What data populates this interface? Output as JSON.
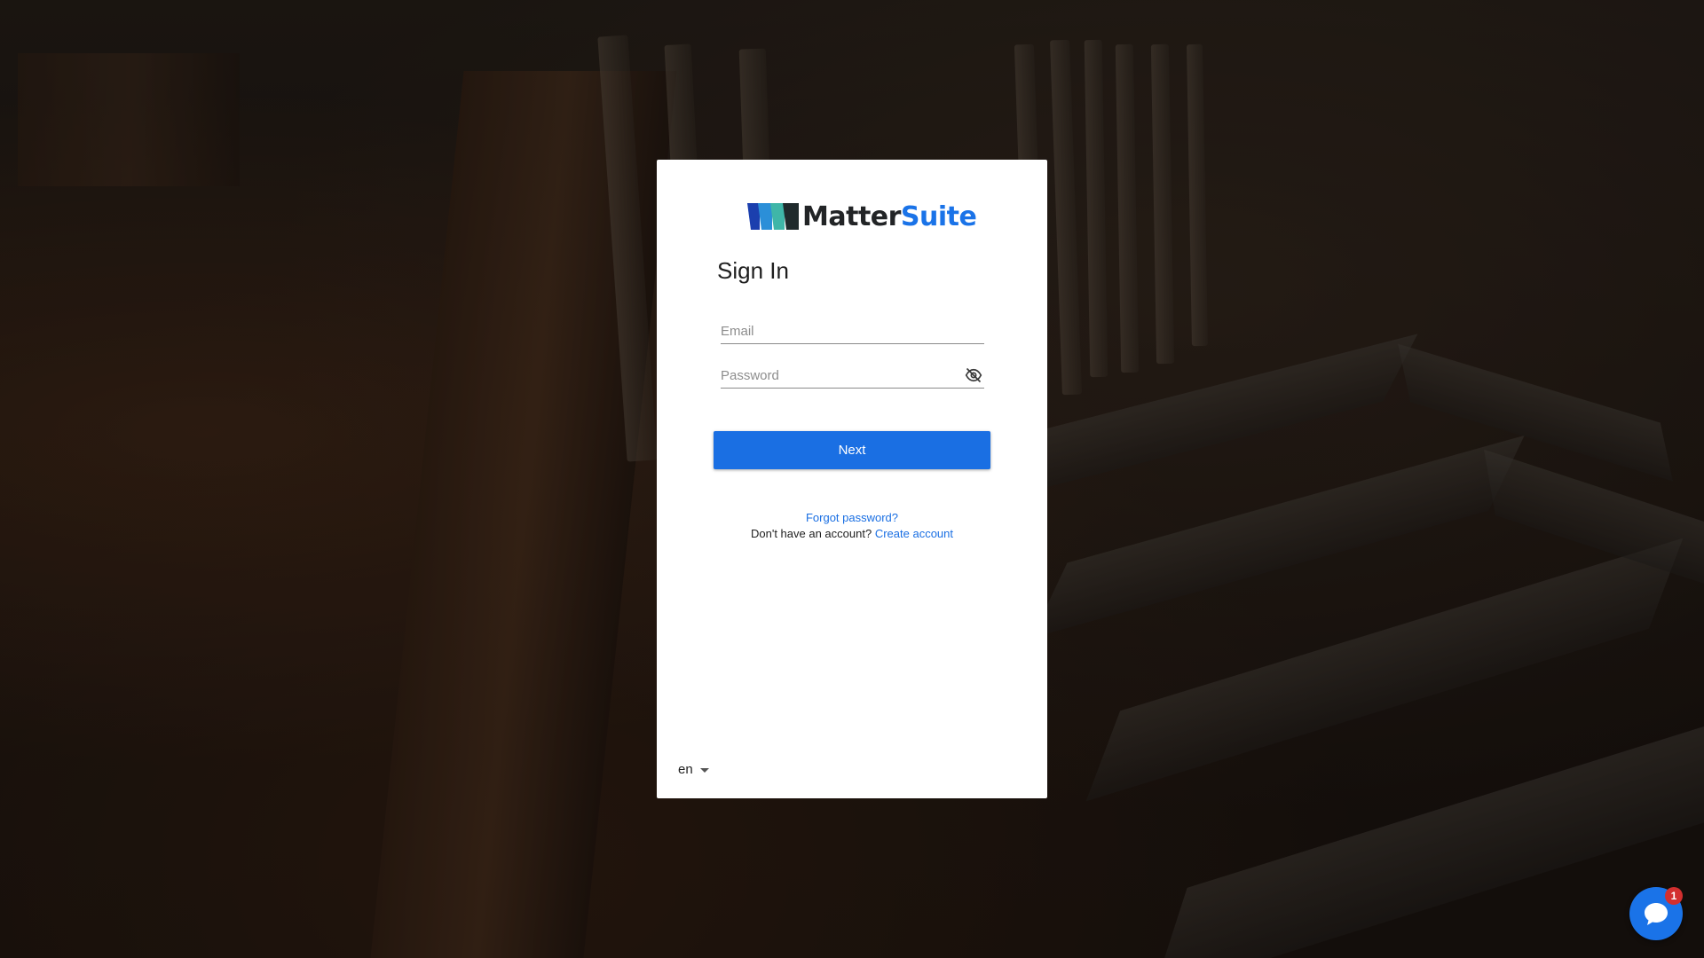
{
  "brand": {
    "name_part1": "Matter",
    "name_part2": "Suite",
    "accent_color": "#1a73e8"
  },
  "signin": {
    "title": "Sign In",
    "email_placeholder": "Email",
    "email_value": "",
    "password_placeholder": "Password",
    "password_value": "",
    "password_toggle_icon": "eye-slash-icon",
    "next_label": "Next"
  },
  "links": {
    "forgot_password": "Forgot password?",
    "no_account_text": "Don't have an account?",
    "create_account": "Create account"
  },
  "language": {
    "selected": "en"
  },
  "chat_widget": {
    "icon": "chat-bubble-icon",
    "badge_count": "1"
  }
}
